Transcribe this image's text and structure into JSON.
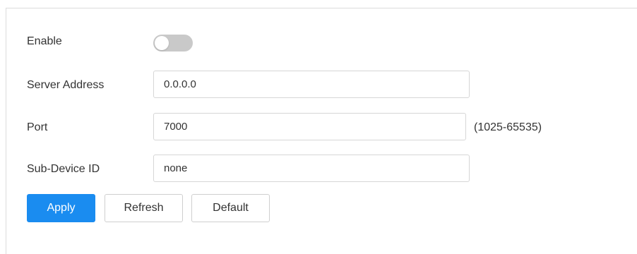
{
  "form": {
    "enable": {
      "label": "Enable",
      "enabled": false
    },
    "server_address": {
      "label": "Server Address",
      "value": "0.0.0.0"
    },
    "port": {
      "label": "Port",
      "value": "7000",
      "range_hint": "(1025-65535)"
    },
    "sub_device_id": {
      "label": "Sub-Device ID",
      "value": "none"
    }
  },
  "actions": {
    "apply_label": "Apply",
    "refresh_label": "Refresh",
    "default_label": "Default"
  },
  "colors": {
    "primary": "#1a8cf0",
    "toggle_off": "#c9c9c9"
  }
}
